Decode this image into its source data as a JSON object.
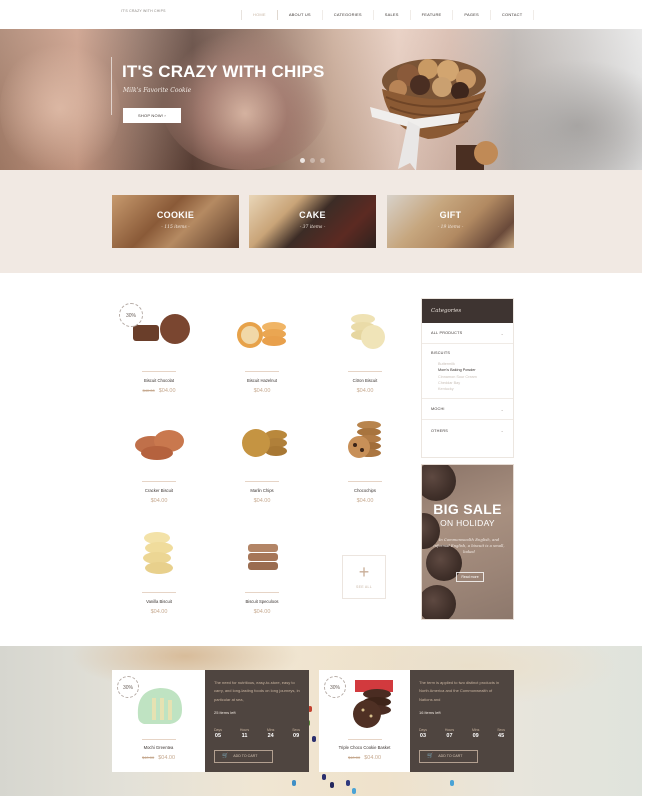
{
  "header": {
    "logo": "IT'S CRAZY WITH CHIPS",
    "nav": [
      {
        "label": "HOME",
        "active": true
      },
      {
        "label": "ABOUT US"
      },
      {
        "label": "CATEGORIES"
      },
      {
        "label": "SALES"
      },
      {
        "label": "FEATURE"
      },
      {
        "label": "PAGES"
      },
      {
        "label": "CONTACT"
      }
    ]
  },
  "hero": {
    "title": "IT'S CRAZY WITH CHIPS",
    "subtitle": "Milk's Favorite Cookie",
    "button": "SHOP NOW! ›",
    "slides": 3,
    "active_slide": 1
  },
  "categories_band": [
    {
      "title": "COOKIE",
      "count": "- 115 items -"
    },
    {
      "title": "CAKE",
      "count": "- 37 items -"
    },
    {
      "title": "GIFT",
      "count": "- 19 items -"
    }
  ],
  "products": [
    {
      "name": "Biscuit Chocolat",
      "old_price": "$40.00",
      "price": "$04.00",
      "badge": "30%"
    },
    {
      "name": "Biscuit Hazelnut",
      "price": "$04.00"
    },
    {
      "name": "Citron Biscuit",
      "price": "$04.00"
    },
    {
      "name": "Cracker Biscuit",
      "price": "$04.00"
    },
    {
      "name": "Marlin Chips",
      "price": "$04.00"
    },
    {
      "name": "Chocochips",
      "price": "$04.00"
    },
    {
      "name": "Vanilla Biscuit",
      "price": "$04.00"
    },
    {
      "name": "Biscuit Speculoos",
      "price": "$04.00"
    }
  ],
  "see_all": {
    "icon": "plus-icon",
    "label": "SEE ALL"
  },
  "sidebar": {
    "title": "Categories",
    "rows": [
      {
        "label": "ALL PRODUCTS"
      },
      {
        "label": "MOCHI"
      },
      {
        "label": "OTHERS"
      }
    ],
    "biscuits": {
      "heading": "BISCUITS",
      "items": [
        {
          "label": "Buttermilk"
        },
        {
          "label": "Mom's Baking Powder",
          "active": true
        },
        {
          "label": "Cinnamon Sour Cream"
        },
        {
          "label": "Cheddar Bay"
        },
        {
          "label": "Kentucky"
        }
      ]
    }
  },
  "sale_banner": {
    "title": "BIG SALE",
    "subtitle": "ON HOLIDAY",
    "description": "In Commonwealth English, and informal English, a biscuit is a small, baked",
    "button": "Read more"
  },
  "deals": [
    {
      "name": "Mochi Greentea",
      "old_price": "$40.00",
      "price": "$04.00",
      "badge": "30%",
      "description": "The need for nutritious, easy-to-store, easy to carry, and long-lasting foods on long journeys, in particular at sea,",
      "items_left": "25 items left",
      "countdown": [
        {
          "unit": "Days",
          "value": "05"
        },
        {
          "unit": "Hours",
          "value": "11"
        },
        {
          "unit": "Mins",
          "value": "24"
        },
        {
          "unit": "Secs",
          "value": "09"
        }
      ],
      "button": "ADD TO CART"
    },
    {
      "name": "Triple Choco Cookie Basket",
      "old_price": "$40.00",
      "price": "$04.00",
      "badge": "30%",
      "description": "The term is applied to two distinct products in North America and the Commonwealth of Nations and",
      "items_left": "16 items left",
      "countdown": [
        {
          "unit": "Days",
          "value": "03"
        },
        {
          "unit": "Hours",
          "value": "07"
        },
        {
          "unit": "Mins",
          "value": "09"
        },
        {
          "unit": "Secs",
          "value": "45"
        }
      ],
      "button": "ADD TO CART"
    }
  ],
  "colors": {
    "accent": "#c6a98f",
    "dark": "#4f4540",
    "band": "#f1e9e3",
    "sidebar_head": "#3e3431"
  }
}
